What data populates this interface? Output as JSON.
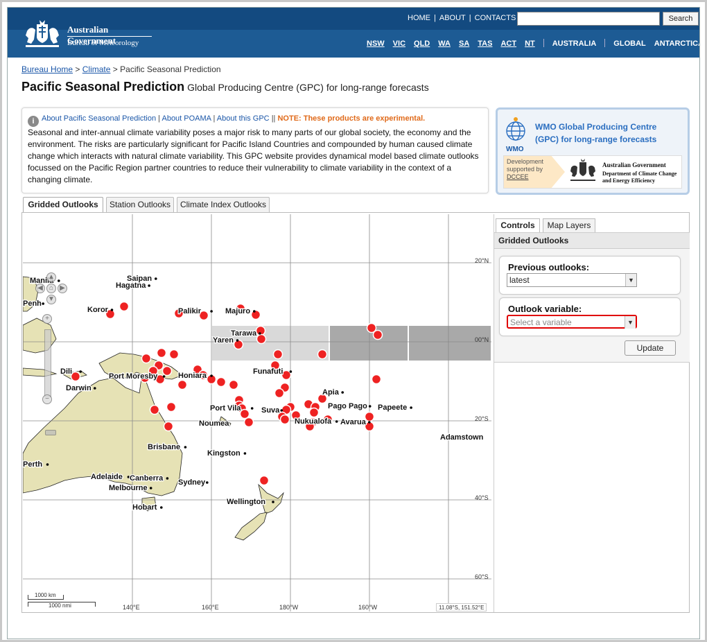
{
  "header": {
    "org_line1": "Australian Government",
    "org_line2": "Bureau of Meteorology",
    "top_links": [
      "HOME",
      "ABOUT",
      "CONTACTS"
    ],
    "search_placeholder": "",
    "search_button": "Search",
    "regions": [
      "NSW",
      "VIC",
      "QLD",
      "WA",
      "SA",
      "TAS",
      "ACT",
      "NT"
    ],
    "region_bold": [
      "AUSTRALIA",
      "GLOBAL",
      "ANTARCTICA"
    ]
  },
  "breadcrumb": {
    "home": "Bureau Home",
    "climate": "Climate",
    "current": "Pacific Seasonal Prediction",
    "sep": ">"
  },
  "page": {
    "title": "Pacific Seasonal Prediction",
    "subtitle": "Global Producing Centre (GPC) for long-range forecasts"
  },
  "info": {
    "icon": "info-icon",
    "links": [
      "About Pacific Seasonal Prediction",
      "About POAMA",
      "About this GPC"
    ],
    "note": "NOTE: These products are experimental.",
    "text": "Seasonal and inter-annual climate variability poses a major risk to many parts of our global society, the economy and the environment. The risks are particularly significant for Pacific Island Countries and compounded by human caused climate change which interacts with natural climate variability. This GPC website provides dynamical model based climate outlooks focussed on the Pacific Region partner countries to reduce their vulnerability to climate variability in the context of a changing climate."
  },
  "wmo": {
    "label": "WMO",
    "title_line1": "WMO Global Producing Centre",
    "title_line2": "(GPC) for long-range forecasts",
    "dev_line1": "Development",
    "dev_line2": "supported by",
    "dev_line3": "DCCEE",
    "gov": "Australian Government",
    "dept_line1": "Department of Climate Change",
    "dept_line2": "and Energy Efficiency"
  },
  "tabs": [
    "Gridded Outlooks",
    "Station Outlooks",
    "Climate Index Outlooks"
  ],
  "active_tab": 0,
  "map": {
    "lat_labels": [
      "20°N",
      "00°N",
      "20°S",
      "40°S",
      "60°S"
    ],
    "lon_labels": [
      "140°E",
      "160°E",
      "180°W",
      "160°W"
    ],
    "places": [
      "Saipan",
      "Hagatna",
      "Koror",
      "Palikir",
      "Majuro",
      "Tarawa",
      "Yaren",
      "Port Moresby",
      "Honiara",
      "Darwin",
      "Dili",
      "Funafuti",
      "Apia",
      "Pago Pago",
      "Papeete",
      "Port Vila",
      "Suva",
      "Nukualofa",
      "Avarua",
      "Noumea",
      "Adamstown",
      "Brisbane",
      "Kingston",
      "Adelaide",
      "Canberra",
      "Sydney",
      "Melbourne",
      "Hobart",
      "Wellington",
      "Perth",
      "Manila",
      "Penh"
    ],
    "coord": "11.08°S, 151.52°E",
    "scale_km": "1000 km",
    "scale_mi": "1000 nmi",
    "land_color": "#e6e2b5",
    "station_color": "#ee2222"
  },
  "controls": {
    "tabs": [
      "Controls",
      "Map Layers"
    ],
    "header": "Gridded Outlooks",
    "prev_label": "Previous outlooks:",
    "prev_value": "latest",
    "var_label": "Outlook variable:",
    "var_placeholder": "Select a variable",
    "update": "Update"
  }
}
